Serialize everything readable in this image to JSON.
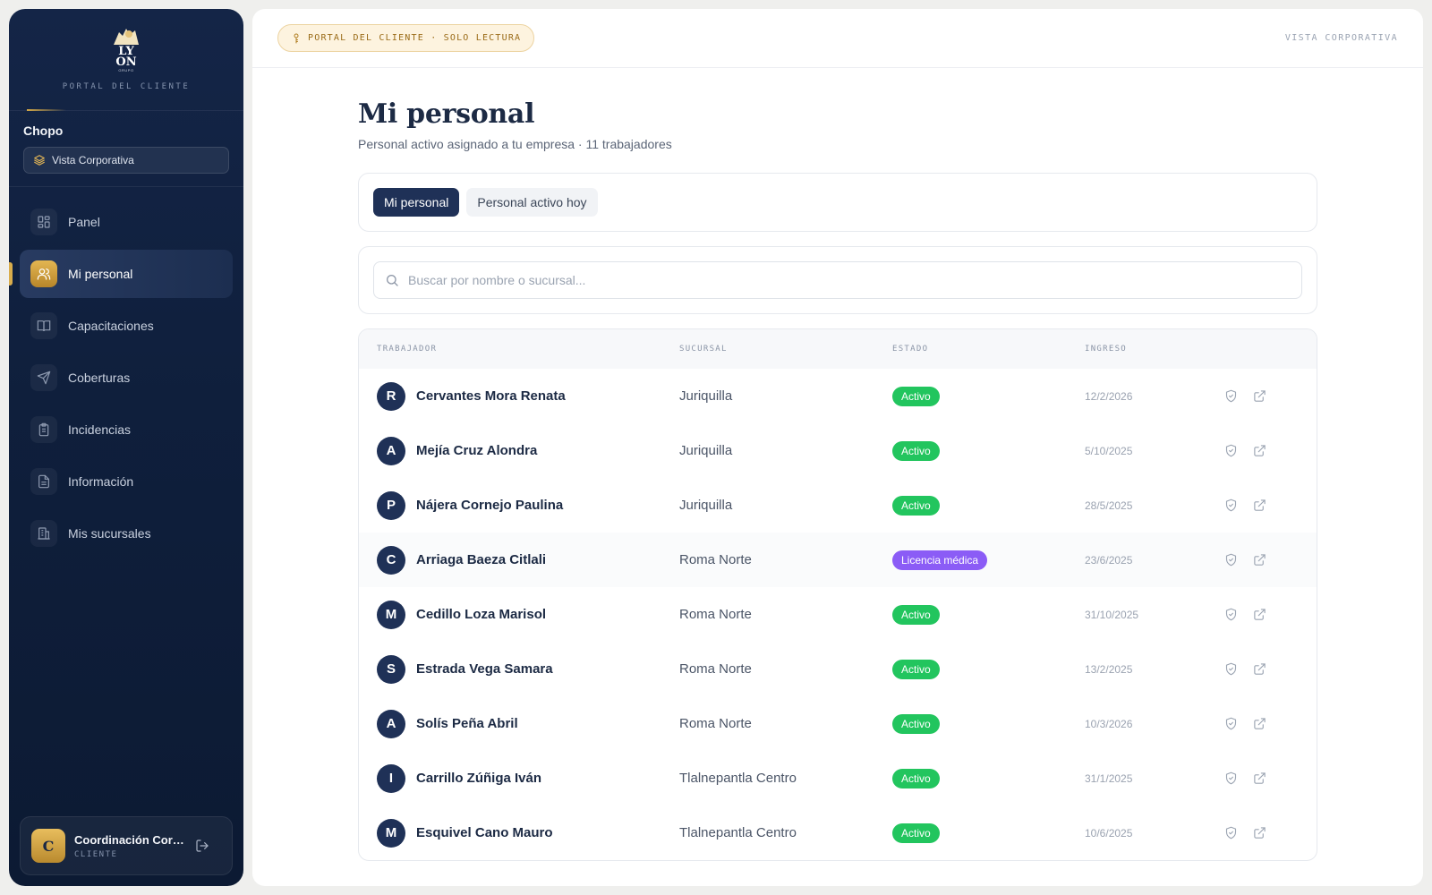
{
  "sidebar": {
    "brand_text": "PORTAL DEL CLIENTE",
    "logo_lines": [
      "LY",
      "ON"
    ],
    "logo_small": "GRUPO",
    "client_name": "Chopo",
    "view_label": "Vista Corporativa",
    "nav": [
      {
        "label": "Panel",
        "icon": "dashboard-icon",
        "active": false
      },
      {
        "label": "Mi personal",
        "icon": "users-icon",
        "active": true
      },
      {
        "label": "Capacitaciones",
        "icon": "book-icon",
        "active": false
      },
      {
        "label": "Coberturas",
        "icon": "send-icon",
        "active": false
      },
      {
        "label": "Incidencias",
        "icon": "clipboard-icon",
        "active": false
      },
      {
        "label": "Información",
        "icon": "document-icon",
        "active": false
      },
      {
        "label": "Mis sucursales",
        "icon": "building-icon",
        "active": false
      }
    ],
    "user": {
      "initial": "C",
      "name": "Coordinación Corporativa",
      "role": "CLIENTE"
    }
  },
  "topbar": {
    "readonly_label": "PORTAL DEL CLIENTE · SOLO LECTURA",
    "right_label": "VISTA CORPORATIVA"
  },
  "page": {
    "title": "Mi personal",
    "subtitle": "Personal activo asignado a tu empresa · 11 trabajadores"
  },
  "tabs": [
    {
      "label": "Mi personal",
      "active": true
    },
    {
      "label": "Personal activo hoy",
      "active": false
    }
  ],
  "search": {
    "placeholder": "Buscar por nombre o sucursal...",
    "value": ""
  },
  "table": {
    "headers": {
      "worker": "TRABAJADOR",
      "branch": "SUCURSAL",
      "status": "ESTADO",
      "entry": "INGRESO"
    },
    "rows": [
      {
        "initial": "R",
        "name": "Cervantes Mora Renata",
        "branch": "Juriquilla",
        "status": "Activo",
        "entry": "12/2/2026"
      },
      {
        "initial": "A",
        "name": "Mejía Cruz Alondra",
        "branch": "Juriquilla",
        "status": "Activo",
        "entry": "5/10/2025"
      },
      {
        "initial": "P",
        "name": "Nájera Cornejo Paulina",
        "branch": "Juriquilla",
        "status": "Activo",
        "entry": "28/5/2025"
      },
      {
        "initial": "C",
        "name": "Arriaga Baeza Citlali",
        "branch": "Roma Norte",
        "status": "Licencia médica",
        "entry": "23/6/2025"
      },
      {
        "initial": "M",
        "name": "Cedillo Loza Marisol",
        "branch": "Roma Norte",
        "status": "Activo",
        "entry": "31/10/2025"
      },
      {
        "initial": "S",
        "name": "Estrada Vega Samara",
        "branch": "Roma Norte",
        "status": "Activo",
        "entry": "13/2/2025"
      },
      {
        "initial": "A",
        "name": "Solís Peña Abril",
        "branch": "Roma Norte",
        "status": "Activo",
        "entry": "10/3/2026"
      },
      {
        "initial": "I",
        "name": "Carrillo Zúñiga Iván",
        "branch": "Tlalnepantla Centro",
        "status": "Activo",
        "entry": "31/1/2025"
      },
      {
        "initial": "M",
        "name": "Esquivel Cano Mauro",
        "branch": "Tlalnepantla Centro",
        "status": "Activo",
        "entry": "10/6/2025"
      }
    ]
  },
  "colors": {
    "sidebar_bg": "#0f1f3c",
    "accent_gold": "#d4a947",
    "primary_navy": "#1f3157",
    "status_active": "#22c55e",
    "status_medical": "#8b5cf6"
  }
}
